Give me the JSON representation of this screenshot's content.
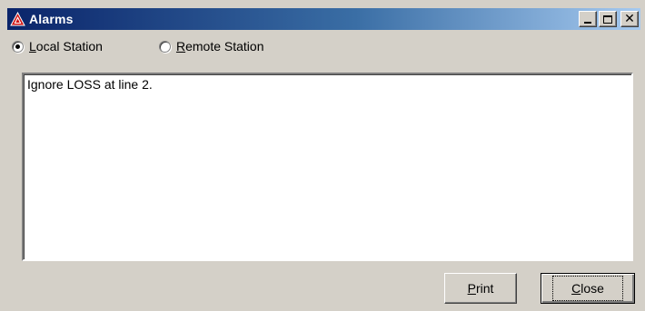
{
  "window": {
    "title": "Alarms",
    "title_bar_colors": [
      "#0a246a",
      "#a6caf0"
    ],
    "app_icon": "alarm-triangle-icon",
    "controls": {
      "minimize_icon": "minimize-icon",
      "maximize_icon": "maximize-icon",
      "close_icon": "close-icon"
    }
  },
  "station_selector": {
    "options": [
      {
        "mnemonic": "L",
        "rest": "ocal Station",
        "selected": true
      },
      {
        "mnemonic": "R",
        "rest": "emote Station",
        "selected": false
      }
    ]
  },
  "alarms": {
    "text": "Ignore LOSS at line 2."
  },
  "buttons": {
    "print": {
      "mnemonic": "P",
      "rest": "rint"
    },
    "close": {
      "mnemonic": "C",
      "rest": "lose"
    }
  },
  "colors": {
    "face": "#d4d0c8",
    "icon_red": "#d01010"
  }
}
